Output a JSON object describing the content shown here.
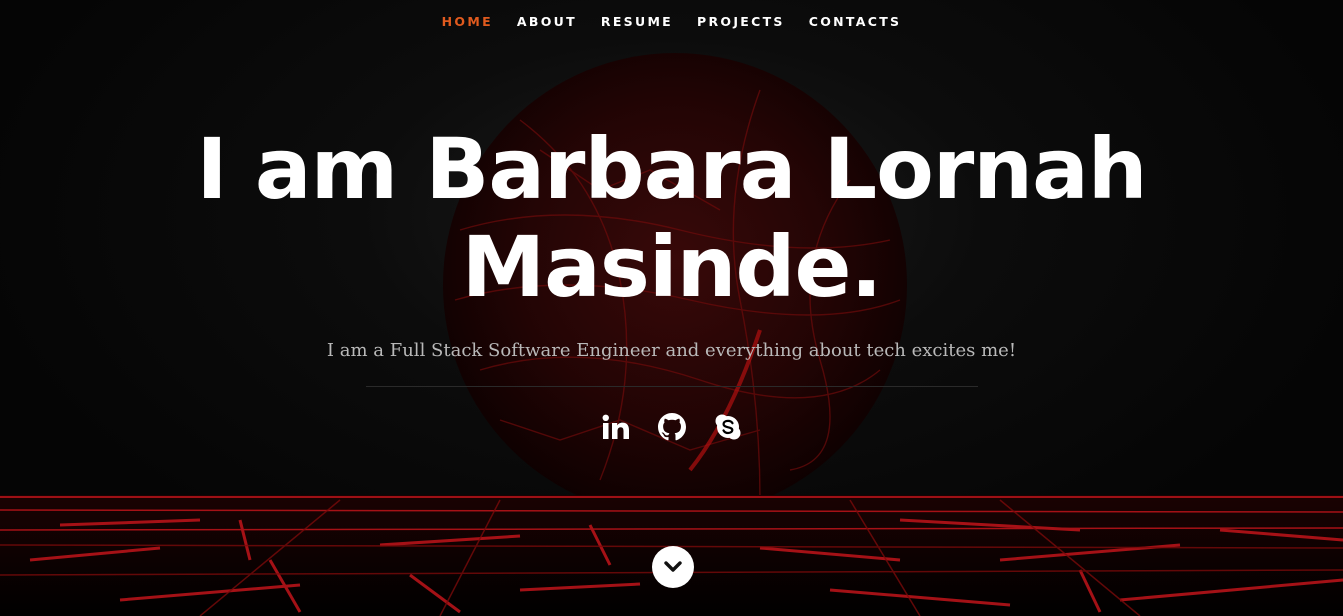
{
  "nav": {
    "items": [
      {
        "label": "HOME",
        "active": true
      },
      {
        "label": "ABOUT",
        "active": false
      },
      {
        "label": "RESUME",
        "active": false
      },
      {
        "label": "PROJECTS",
        "active": false
      },
      {
        "label": "CONTACTS",
        "active": false
      }
    ]
  },
  "hero": {
    "headline_line1": "I am Barbara Lornah",
    "headline_line2": "Masinde.",
    "subtitle": "I am a Full Stack Software Engineer and everything about tech excites me!"
  },
  "socials": [
    {
      "icon": "linkedin-icon"
    },
    {
      "icon": "github-icon"
    },
    {
      "icon": "skype-icon"
    }
  ],
  "scroll": {
    "icon": "chevron-down-icon"
  },
  "colors": {
    "accent": "#e05a1e",
    "background": "#000000",
    "grid_red": "#c0141a",
    "text": "#ffffff",
    "subtitle": "#b9b9b9"
  }
}
